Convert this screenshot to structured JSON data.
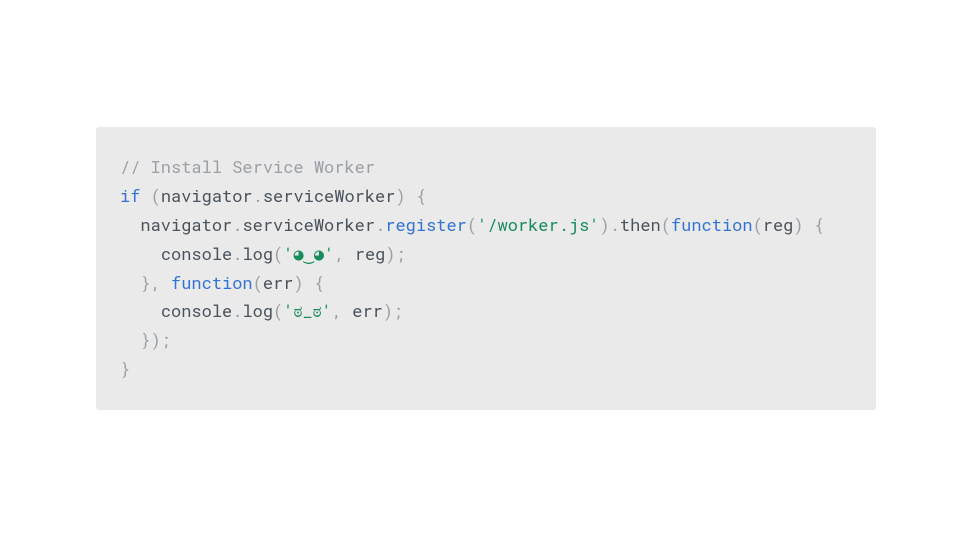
{
  "code": {
    "l1": {
      "comment": "// Install Service Worker"
    },
    "l2": {
      "kw_if": "if",
      "sp_open": " (",
      "ident1": "navigator",
      "dot1": ".",
      "ident2": "serviceWorker",
      "close": ") {"
    },
    "l3": {
      "indent": "  ",
      "ident1": "navigator",
      "dot1": ".",
      "ident2": "serviceWorker",
      "dot2": ".",
      "method": "register",
      "open_p": "(",
      "string": "'/worker.js'",
      "close_p": ")",
      "dot3": ".",
      "then": "then",
      "open_p2": "(",
      "kw_fn": "function",
      "open_p3": "(",
      "arg": "reg",
      "close_p3": ") {"
    },
    "l4": {
      "indent": "    ",
      "console": "console",
      "dot": ".",
      "log": "log",
      "open": "(",
      "string": "'◕‿◕'",
      "comma": ", ",
      "arg": "reg",
      "close": ");"
    },
    "l5": {
      "indent": "  ",
      "brace": "}, ",
      "kw_fn": "function",
      "open": "(",
      "arg": "err",
      "close": ") {"
    },
    "l6": {
      "indent": "    ",
      "console": "console",
      "dot": ".",
      "log": "log",
      "open": "(",
      "string": "'ಠ_ಠ'",
      "comma": ", ",
      "arg": "err",
      "close": ");"
    },
    "l7": {
      "indent": "  ",
      "text": "});"
    },
    "l8": {
      "text": "}"
    }
  }
}
